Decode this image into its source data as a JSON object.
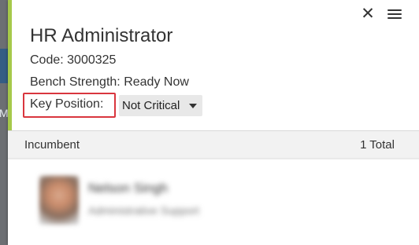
{
  "backdrop": {
    "partial_letter": "Ma"
  },
  "card": {
    "title": "HR Administrator",
    "code_label": "Code:",
    "code_value": "3000325",
    "bench_label": "Bench Strength:",
    "bench_value": "Ready Now",
    "key_position_label": "Key Position:",
    "key_position_value": "Not Critical",
    "accent_color": "#a6c94a",
    "highlight_color": "#d9363e"
  },
  "incumbent": {
    "label": "Incumbent",
    "total": "1 Total",
    "person": {
      "name": "Nelson Singh",
      "role": "Administrative Support"
    }
  }
}
